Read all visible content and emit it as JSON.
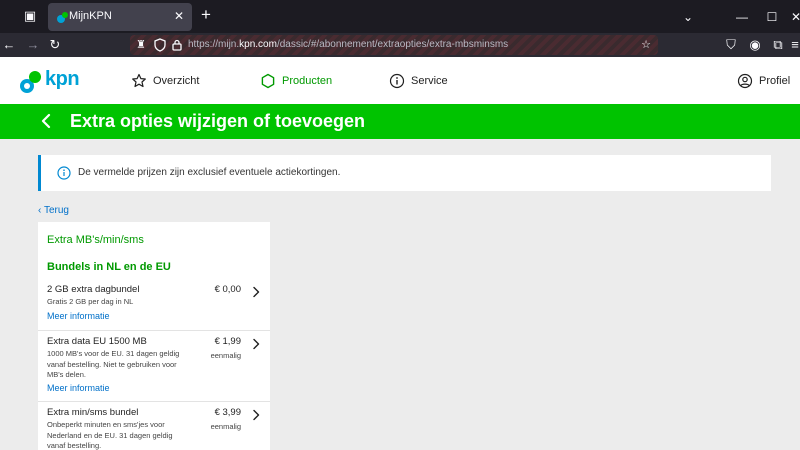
{
  "browser": {
    "tab_title": "MijnKPN",
    "url_prefix": "https://mijn.",
    "url_domain": "kpn.com",
    "url_path": "/dassic/#/abonnement/extraopties/extra-mbsminsms"
  },
  "header": {
    "logo_text": "kpn",
    "menu": [
      {
        "label": "Overzicht",
        "icon": "star-icon"
      },
      {
        "label": "Producten",
        "icon": "hexagon-icon",
        "active": true
      },
      {
        "label": "Service",
        "icon": "info-icon"
      }
    ],
    "profile_label": "Profiel"
  },
  "page": {
    "title": "Extra opties wijzigen of toevoegen",
    "notice": "De vermelde prijzen zijn exclusief eventuele actiekortingen.",
    "back_link": "Terug"
  },
  "card": {
    "heading": "Extra MB's/min/sms",
    "subheading": "Bundels in NL en de EU",
    "options": [
      {
        "title": "2 GB extra dagbundel",
        "description": "Gratis 2 GB per dag in NL",
        "price": "€ 0,00",
        "frequency": "",
        "more": "Meer informatie"
      },
      {
        "title": "Extra data EU 1500 MB",
        "description": "1000 MB's voor de EU. 31 dagen geldig vanaf bestelling. Niet te gebruiken voor MB's delen.",
        "price": "€ 1,99",
        "frequency": "eenmalig",
        "more": "Meer informatie"
      },
      {
        "title": "Extra min/sms bundel",
        "description": "Onbeperkt minuten en sms'jes voor Nederland en de EU. 31 dagen geldig vanaf bestelling.",
        "price": "€ 3,99",
        "frequency": "eenmalig",
        "more": ""
      }
    ]
  },
  "colors": {
    "brand_green": "#00c300",
    "link_blue": "#0070c9",
    "notice_accent": "#0088d1"
  }
}
